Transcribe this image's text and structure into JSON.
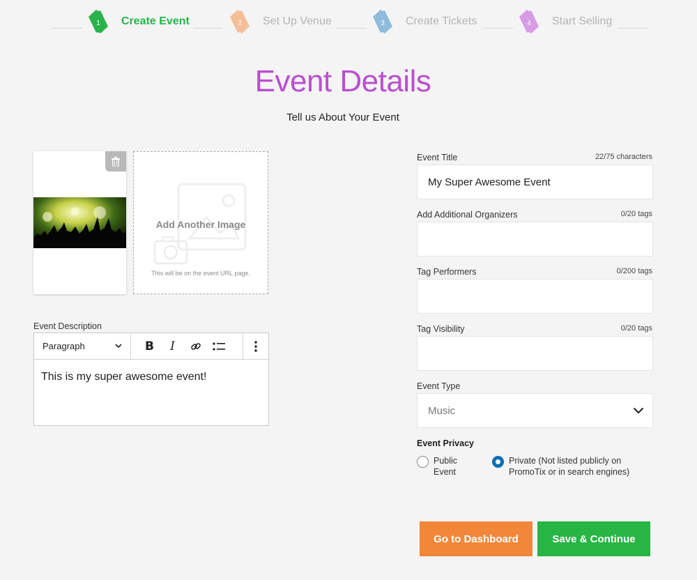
{
  "stepper": {
    "steps": [
      {
        "number": "1",
        "label": "Create Event",
        "color": "#29b34a",
        "active": true
      },
      {
        "number": "2",
        "label": "Set Up Venue",
        "color": "#f4bf98",
        "active": false
      },
      {
        "number": "3",
        "label": "Create Tickets",
        "color": "#8fbbdc",
        "active": false
      },
      {
        "number": "4",
        "label": "Start Selling",
        "color": "#d89be6",
        "active": false
      }
    ]
  },
  "header": {
    "title": "Event Details",
    "subtitle": "Tell us About Your Event",
    "title_color": "#b94fcf"
  },
  "images": {
    "add_label": "Add Another Image",
    "hint": "This will be on the event URL page."
  },
  "description": {
    "label": "Event Description",
    "block_type": "Paragraph",
    "toolbar": [
      "bold-icon",
      "italic-icon",
      "link-icon",
      "list-icon",
      "more-options-icon"
    ],
    "content": "This is my super awesome event!"
  },
  "form": {
    "event_title": {
      "label": "Event Title",
      "count": "22/75 characters",
      "value": "My Super Awesome Event"
    },
    "organizers": {
      "label": "Add Additional Organizers",
      "count": "0/20 tags",
      "value": ""
    },
    "performers": {
      "label": "Tag Performers",
      "count": "0/200 tags",
      "value": ""
    },
    "visibility": {
      "label": "Tag Visibility",
      "count": "0/20 tags",
      "value": ""
    },
    "event_type": {
      "label": "Event Type",
      "value": "Music"
    },
    "privacy": {
      "label": "Event Privacy",
      "options": [
        {
          "label": "Public Event",
          "line1": "Public",
          "line2": "Event",
          "checked": false
        },
        {
          "label": "Private (Not listed publicly on PromoTix or in search engines)",
          "line1": "Private (Not listed publicly on",
          "line2": "PromoTix or in search engines)",
          "checked": true
        }
      ]
    }
  },
  "actions": {
    "dashboard_label": "Go to Dashboard",
    "save_label": "Save & Continue",
    "dashboard_color": "#f2873a",
    "save_color": "#27b544"
  }
}
